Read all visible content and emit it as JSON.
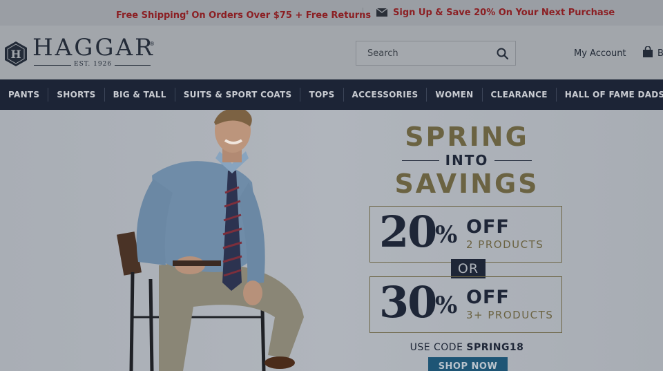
{
  "promo": {
    "shipping_text": "Free Shipping",
    "shipping_mark": "‡",
    "shipping_rest": " On Orders Over $75 + Free Returns",
    "signup_text": "Sign Up & Save 20% On Your Next Purchase"
  },
  "header": {
    "logo_text": "HAGGAR",
    "logo_reg": "®",
    "logo_est": "EST. 1926",
    "search_placeholder": "Search",
    "account_label": "My Account",
    "bag_label": "B"
  },
  "nav": {
    "items": [
      {
        "label": "PANTS"
      },
      {
        "label": "SHORTS"
      },
      {
        "label": "BIG & TALL"
      },
      {
        "label": "SUITS & SPORT COATS"
      },
      {
        "label": "TOPS"
      },
      {
        "label": "ACCESSORIES"
      },
      {
        "label": "WOMEN"
      },
      {
        "label": "CLEARANCE"
      },
      {
        "label": "HALL OF FAME DADS"
      }
    ]
  },
  "hero": {
    "line1": "SPRING",
    "line2": "INTO",
    "line3": "SAVINGS",
    "offers": [
      {
        "big": "20",
        "pct": "%",
        "off": "OFF",
        "sub": "2 PRODUCTS"
      },
      {
        "big": "30",
        "pct": "%",
        "off": "OFF",
        "sub": "3+ PRODUCTS"
      }
    ],
    "or_label": "OR",
    "code_prefix": "USE CODE ",
    "code_value": "SPRING18",
    "cta_label": "SHOP NOW"
  },
  "colors": {
    "promo_text": "#8b1f23",
    "nav_bg": "#1c2436",
    "gold": "#6b6342",
    "navy": "#1e2637",
    "cta_bg": "#1e5575"
  }
}
